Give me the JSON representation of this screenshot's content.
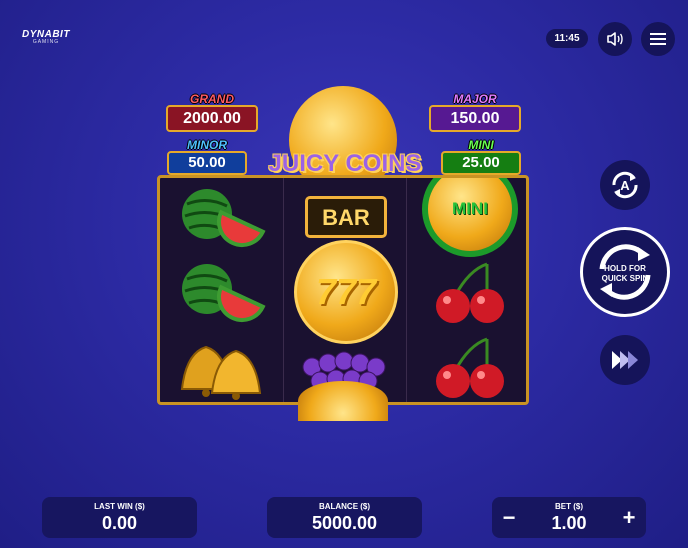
{
  "brand": {
    "name": "DYNABIT",
    "sub": "GAMING"
  },
  "clock": "11:45",
  "icons": {
    "sound": "speaker-icon",
    "menu": "hamburger-menu-icon",
    "autoplay": "autoplay-icon",
    "quickspin": "quick-spin-icon",
    "turbo": "fast-forward-icon"
  },
  "jackpots": {
    "grand": {
      "label": "GRAND",
      "value": "2000.00"
    },
    "major": {
      "label": "MAJOR",
      "value": "150.00"
    },
    "minor": {
      "label": "MINOR",
      "value": "50.00"
    },
    "mini": {
      "label": "MINI",
      "value": "25.00"
    }
  },
  "game_title": "JUICY COINS",
  "reels": {
    "col1": [
      "watermelon",
      "watermelon",
      "bells"
    ],
    "col2": [
      "BAR",
      "seven-coin",
      "grapes"
    ],
    "col3": [
      "mini-coin",
      "cherries",
      "cherries"
    ],
    "mini_coin_text": "MINI",
    "bar_text": "BAR",
    "seven_text": "777"
  },
  "quick_spin_label": "HOLD FOR QUICK SPIN",
  "footer": {
    "last_win_label": "LAST WIN ($)",
    "last_win_value": "0.00",
    "balance_label": "BALANCE ($)",
    "balance_value": "5000.00",
    "bet_label": "BET ($)",
    "bet_value": "1.00",
    "minus": "−",
    "plus": "+"
  }
}
